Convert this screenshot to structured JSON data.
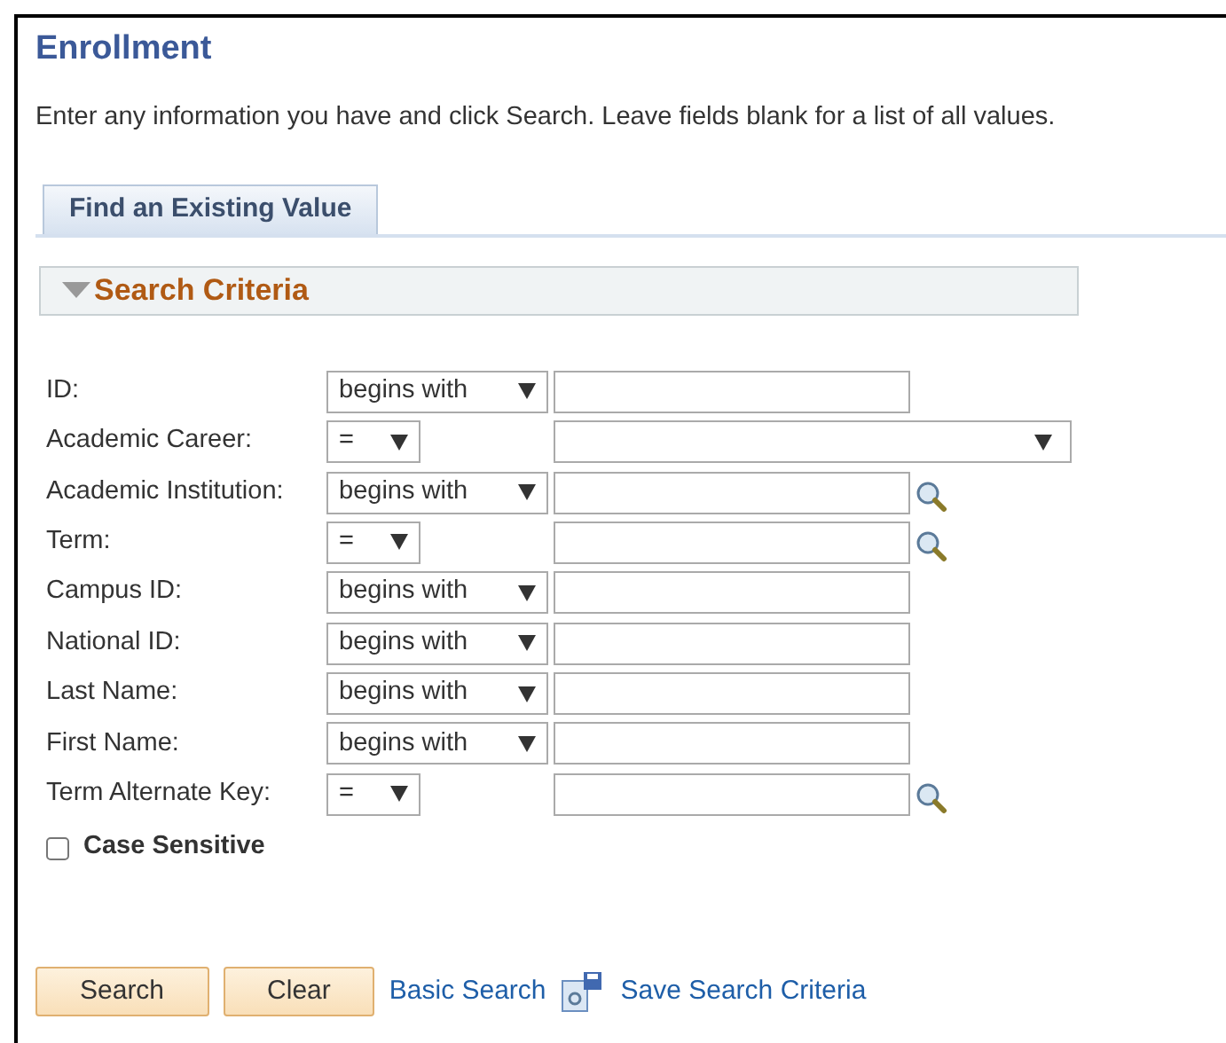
{
  "page": {
    "title": "Enrollment",
    "instructions": "Enter any information you have and click Search. Leave fields blank for a list of all values."
  },
  "tabs": [
    {
      "label": "Find an Existing Value",
      "selected": true
    }
  ],
  "section": {
    "title": "Search Criteria",
    "expanded": true
  },
  "criteria": [
    {
      "label": "ID:",
      "operator": "begins with",
      "kind": "text"
    },
    {
      "label": "Academic Career:",
      "operator": "=",
      "kind": "dropdown"
    },
    {
      "label": "Academic Institution:",
      "operator": "begins with",
      "kind": "lookup"
    },
    {
      "label": "Term:",
      "operator": "=",
      "kind": "lookup"
    },
    {
      "label": "Campus ID:",
      "operator": "begins with",
      "kind": "text"
    },
    {
      "label": "National ID:",
      "operator": "begins with",
      "kind": "text"
    },
    {
      "label": "Last Name:",
      "operator": "begins with",
      "kind": "text"
    },
    {
      "label": "First Name:",
      "operator": "begins with",
      "kind": "text"
    },
    {
      "label": "Term Alternate Key:",
      "operator": "=",
      "kind": "lookup"
    }
  ],
  "case_sensitive": {
    "label": "Case Sensitive",
    "checked": false
  },
  "buttons": [
    "Search",
    "Clear"
  ],
  "links": [
    {
      "label": "Basic Search",
      "kind": "plain"
    },
    {
      "label": "Save Search Criteria",
      "kind": "save"
    }
  ]
}
